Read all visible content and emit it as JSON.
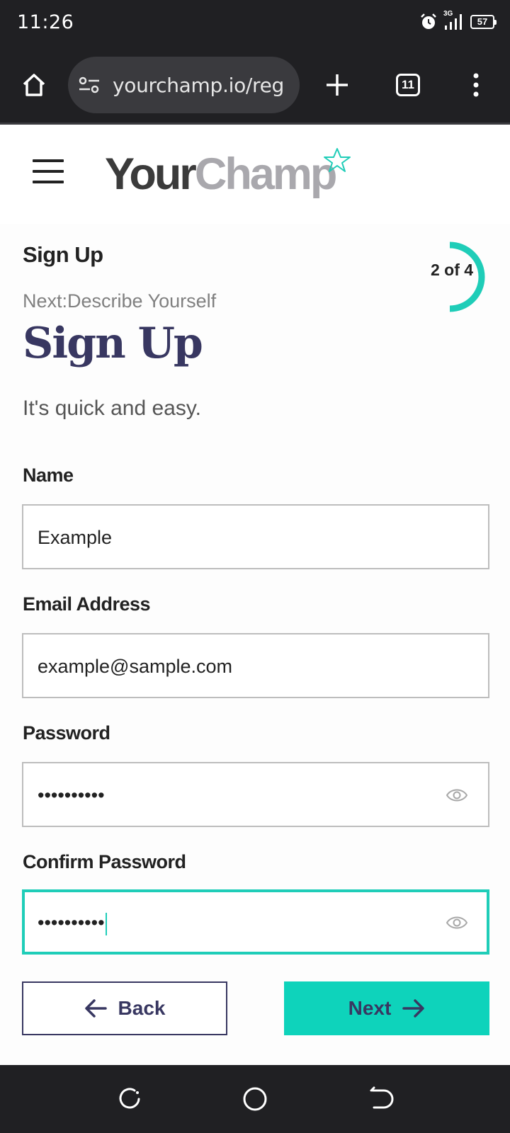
{
  "status_bar": {
    "time": "11:26",
    "network": "3G",
    "battery": "57",
    "icons": [
      "alarm-icon",
      "signal-icon",
      "battery-icon"
    ]
  },
  "browser": {
    "url": "yourchamp.io/reg",
    "tab_count": "11",
    "icons": [
      "home-icon",
      "site-settings-icon",
      "new-tab-icon",
      "tab-switcher-icon",
      "more-menu-icon"
    ]
  },
  "header": {
    "logo_part1": "Your",
    "logo_part2": "Champ"
  },
  "step": {
    "title": "Sign Up",
    "next": "Next:Describe Yourself",
    "progress_label": "2 of 4",
    "current": 2,
    "total": 4
  },
  "form": {
    "heading": "Sign Up",
    "subheading": "It's quick and easy.",
    "name_label": "Name",
    "name_value": "Example",
    "email_label": "Email Address",
    "email_value": "example@sample.com",
    "password_label": "Password",
    "password_value": "••••••••••",
    "confirm_label": "Confirm Password",
    "confirm_value": "••••••••••",
    "back_label": "Back",
    "next_label": "Next"
  },
  "colors": {
    "accent": "#0ed3bb",
    "brand": "#383761",
    "chrome": "#202023"
  }
}
